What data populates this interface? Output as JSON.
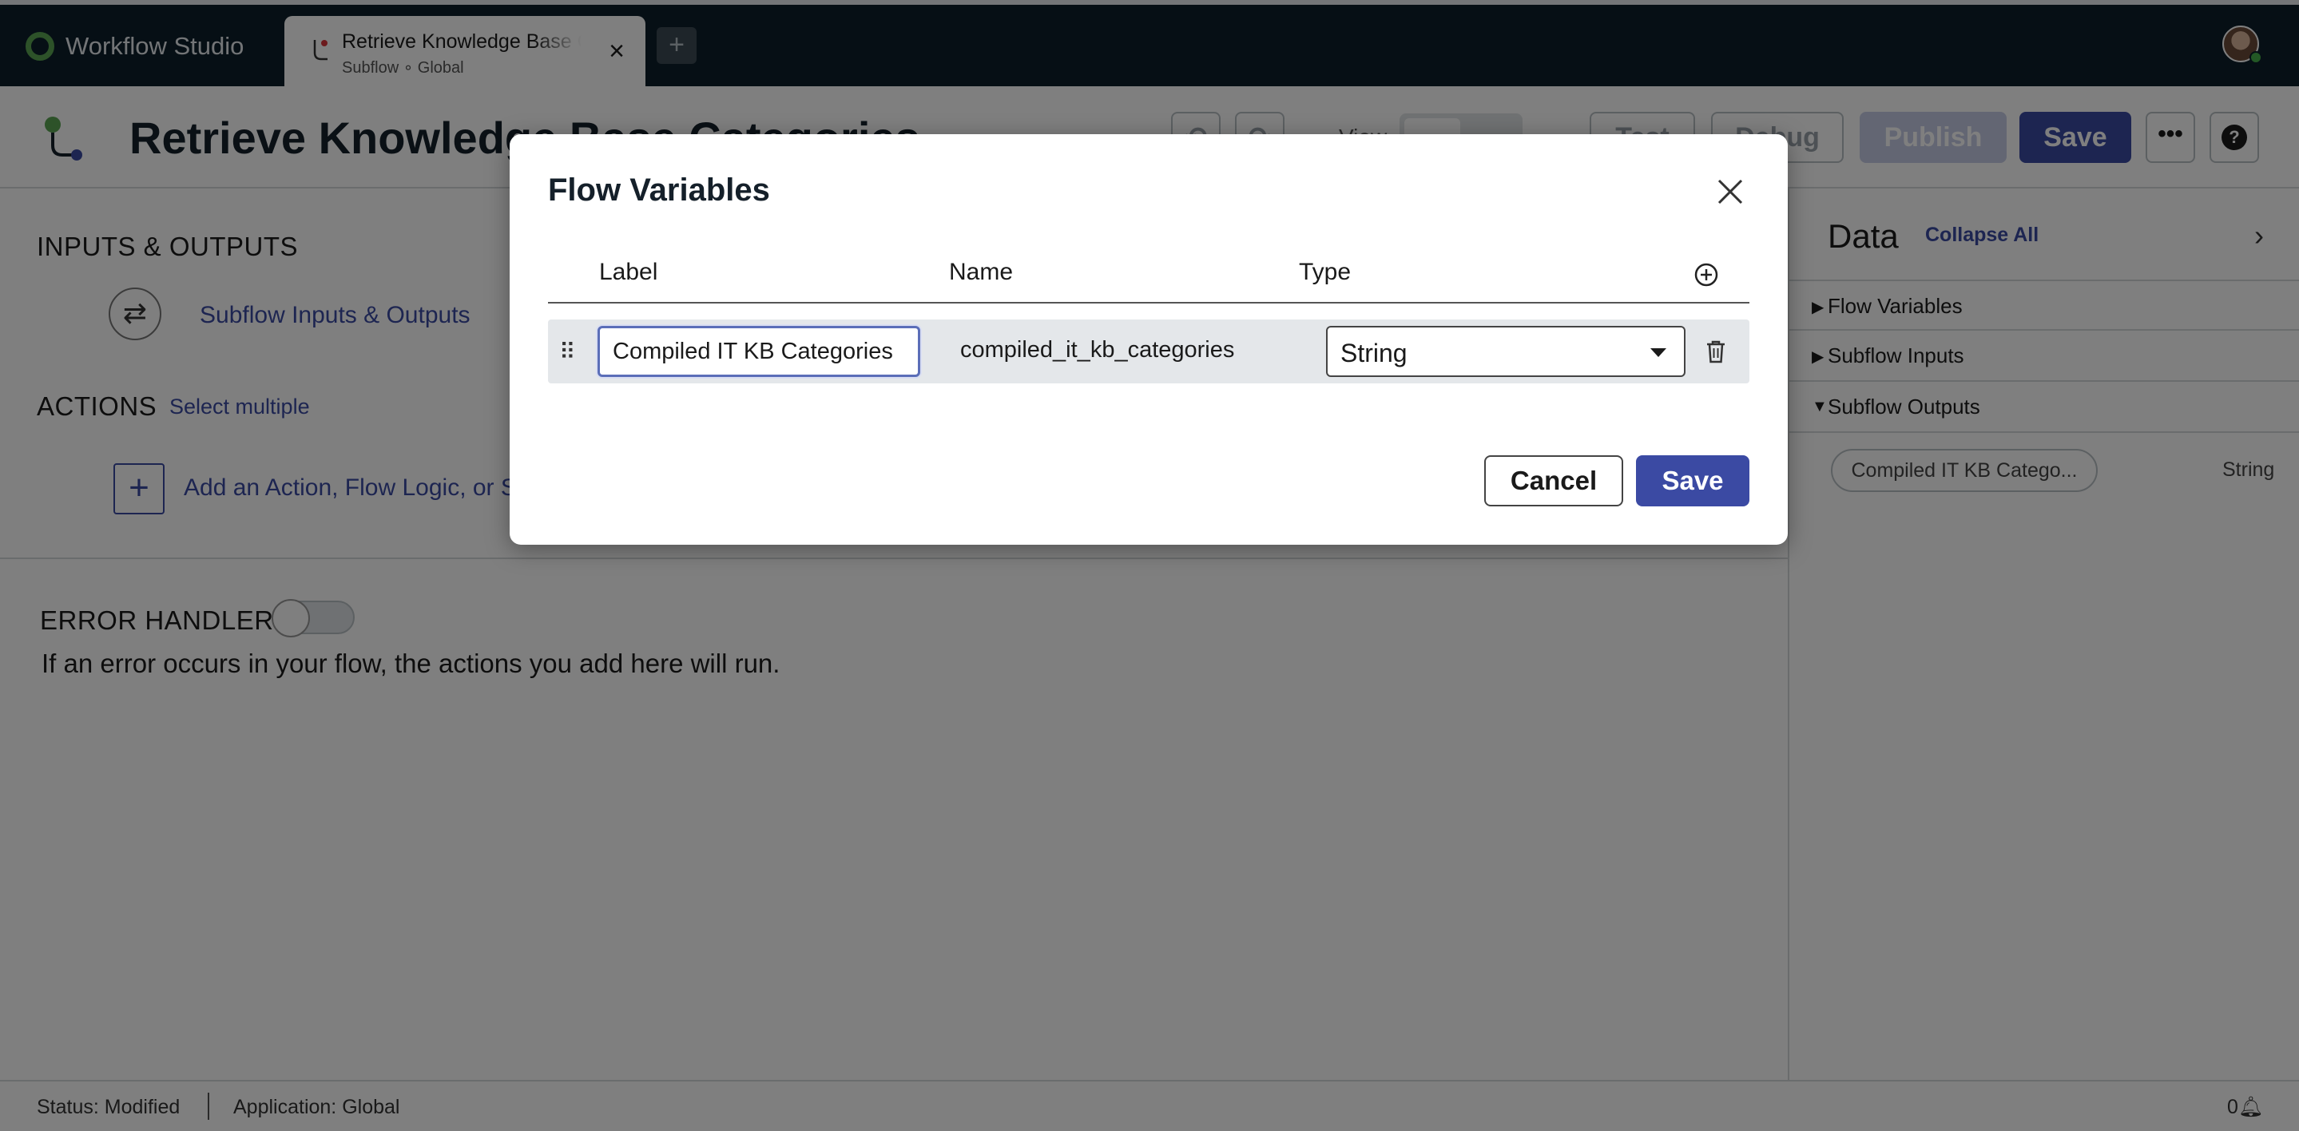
{
  "app": {
    "name": "Workflow Studio"
  },
  "tab": {
    "title": "Retrieve Knowledge Base Categories",
    "subtitle": "Subflow ∘ Global",
    "close": "×",
    "add": "+"
  },
  "header": {
    "title": "Retrieve Knowledge Base Categories",
    "view_label": "View",
    "test_label": "Test",
    "debug_label": "Debug",
    "publish_label": "Publish",
    "save_label": "Save",
    "more_label": "•••",
    "help_label": "?"
  },
  "left": {
    "inputs_outputs_title": "INPUTS & OUTPUTS",
    "subflow_io_link": "Subflow Inputs & Outputs",
    "actions_title": "ACTIONS",
    "select_multiple": "Select multiple",
    "add_action_link": "Add an Action, Flow Logic, or Subflow",
    "error_handler_title": "ERROR HANDLER",
    "error_handler_enabled": false,
    "error_handler_desc": "If an error occurs in your flow, the actions you add here will run."
  },
  "data_panel": {
    "title": "Data",
    "collapse_all": "Collapse All",
    "sections": [
      {
        "label": "Flow Variables",
        "expanded": false
      },
      {
        "label": "Subflow Inputs",
        "expanded": false
      },
      {
        "label": "Subflow Outputs",
        "expanded": true
      }
    ],
    "output_pill": "Compiled IT KB Catego...",
    "output_type": "String"
  },
  "status_bar": {
    "status": "Status: Modified",
    "application": "Application: Global",
    "notifications": "0"
  },
  "modal": {
    "title": "Flow Variables",
    "columns": {
      "label": "Label",
      "name": "Name",
      "type": "Type"
    },
    "rows": [
      {
        "label": "Compiled IT KB Categories",
        "name": "compiled_it_kb_categories",
        "type": "String"
      }
    ],
    "cancel_label": "Cancel",
    "save_label": "Save"
  },
  "colors": {
    "accent": "#3b4aa3",
    "topbar": "#0c1f2b",
    "brand_green": "#5aa552"
  }
}
